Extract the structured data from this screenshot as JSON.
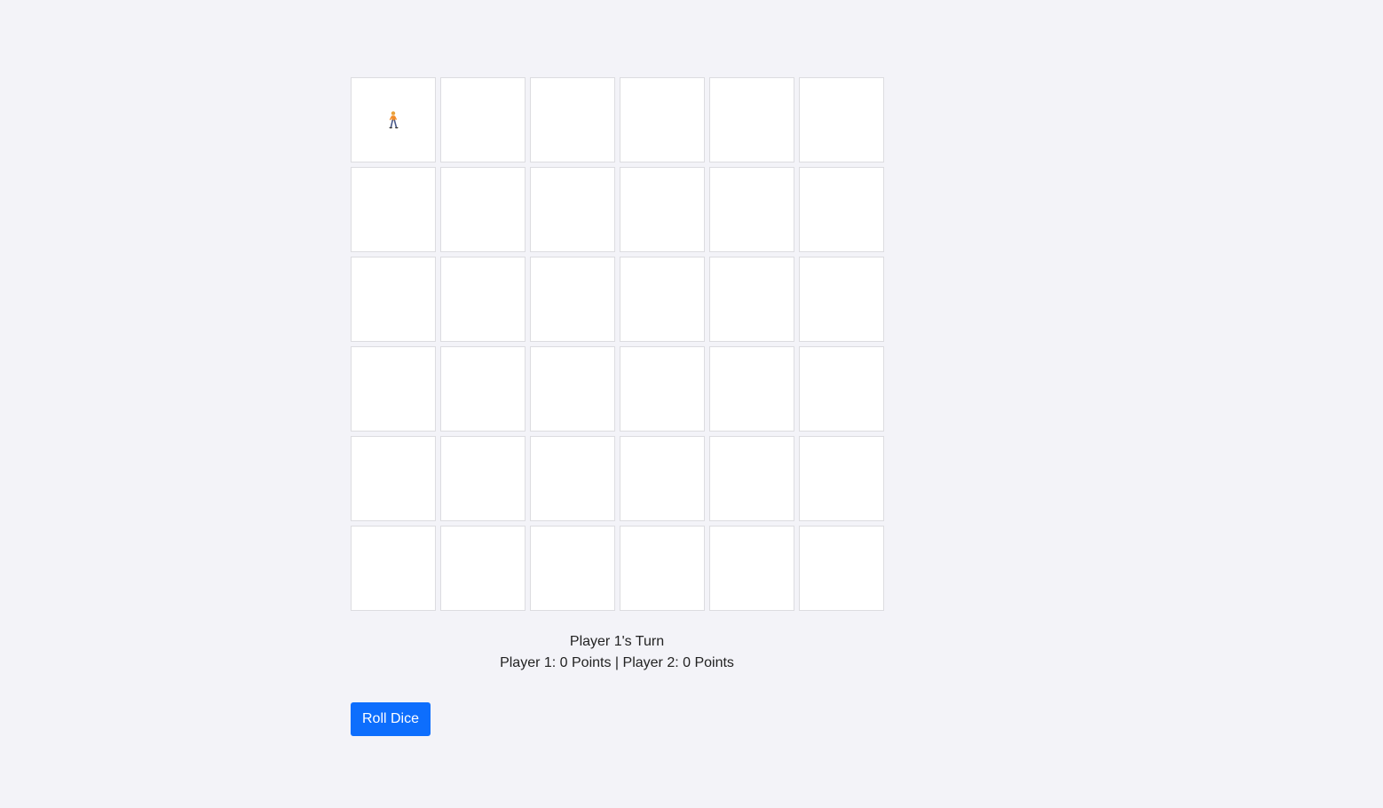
{
  "board": {
    "rows": 6,
    "cols": 6,
    "token": {
      "row": 0,
      "col": 0,
      "icon": "person-walking-icon",
      "color": "#f28c28"
    }
  },
  "status": {
    "turn_text": "Player 1's Turn",
    "score_text": "Player 1: 0 Points | Player 2: 0 Points"
  },
  "controls": {
    "roll_label": "Roll Dice"
  },
  "colors": {
    "background": "#f3f3f8",
    "button": "#0d6efd"
  }
}
